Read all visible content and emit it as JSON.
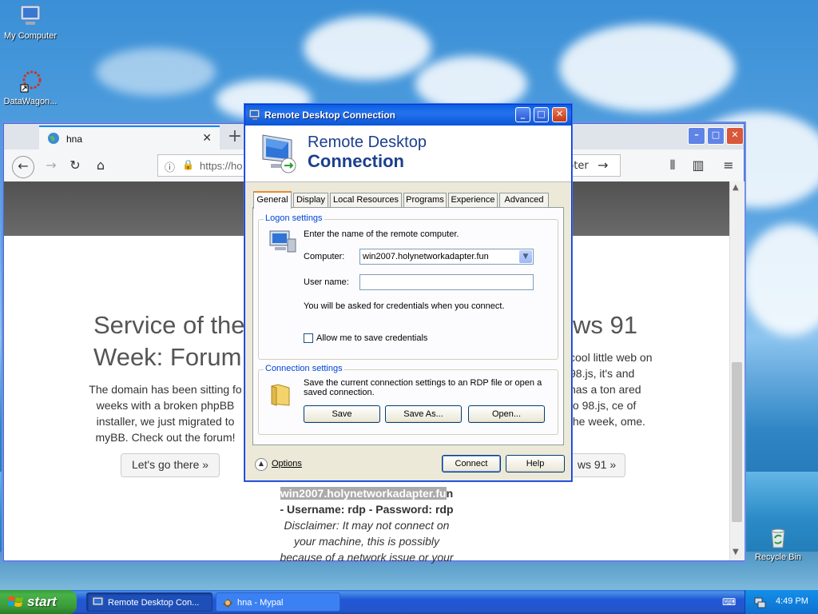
{
  "desktop": {
    "icons": [
      {
        "label": "My Computer",
        "icon": "my-computer-icon"
      },
      {
        "label": "DataWagon...",
        "icon": "datawagon-icon"
      },
      {
        "label": "Recycle Bin",
        "icon": "recycle-bin-icon"
      }
    ]
  },
  "browser": {
    "tab_title": "hna",
    "tab_close": "✕",
    "new_tab": "+",
    "url": "https://ho",
    "url_right_text": "pter",
    "page": {
      "left_heading_l1": "Service of the",
      "left_heading_l2": "Week: Forum",
      "left_para": "The domain has been sitting fo weeks with a broken phpBB installer, we just migrated to myBB. Check out the forum!",
      "left_button": "Let's go there »",
      "right_heading": "ws 91",
      "right_para": "cool little web on 98.js, it's and has a ton ared to 98.js, ce of the week, ome.",
      "right_button": "ws 91 »",
      "mid_highlight": "win2007.holynetworkadapter.fu",
      "mid_tail": "n",
      "mid_creds": "- Username: rdp - Password: rdp",
      "mid_disclaimer": "Disclaimer: It may not connect on your machine, this is possibly because of a network issue or your"
    }
  },
  "rdp": {
    "window_title": "Remote Desktop Connection",
    "banner_line1": "Remote Desktop",
    "banner_line2": "Connection",
    "tabs": [
      "General",
      "Display",
      "Local Resources",
      "Programs",
      "Experience",
      "Advanced"
    ],
    "logon_group": "Logon settings",
    "logon_intro": "Enter the name of the remote computer.",
    "computer_label": "Computer:",
    "computer_value": "win2007.holynetworkadapter.fun",
    "username_label": "User name:",
    "username_value": "",
    "credentials_note": "You will be asked for credentials when you connect.",
    "save_credentials_label": "Allow me to save credentials",
    "connection_group": "Connection settings",
    "connection_text": "Save the current connection settings to an RDP file or open a saved connection.",
    "save_button": "Save",
    "save_as_button": "Save As...",
    "open_button": "Open...",
    "options_label": "Options",
    "connect_button": "Connect",
    "help_button": "Help"
  },
  "taskbar": {
    "start_label": "start",
    "items": [
      {
        "label": "Remote Desktop Con..."
      },
      {
        "label": "hna - Mypal"
      }
    ],
    "clock": "4:49 PM"
  },
  "colors": {
    "xp_blue": "#0a5fe0",
    "start_green": "#3c9a3c",
    "dialog_bg": "#ece9d8",
    "group_label": "#0046d5"
  }
}
